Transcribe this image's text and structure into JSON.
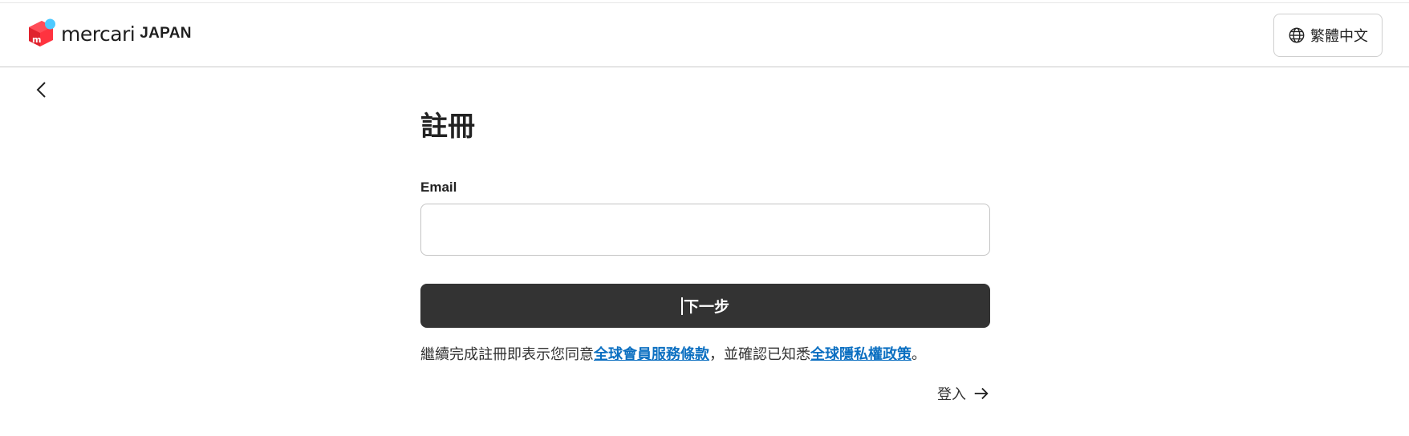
{
  "header": {
    "logo": {
      "wordmark": "mercari",
      "country": "JAPAN",
      "mark_letter": "m",
      "icon": "mercari-logo-icon"
    },
    "language_button": {
      "label": "繁體中文",
      "icon": "globe-icon"
    }
  },
  "nav": {
    "back_icon": "chevron-left-icon"
  },
  "form": {
    "title": "註冊",
    "email_label": "Email",
    "email_value": "",
    "email_placeholder": "",
    "next_button_label": "下一步"
  },
  "terms": {
    "prefix": "繼續完成註冊即表示您同意",
    "terms_link": "全球會員服務條款",
    "middle": "，並確認已知悉",
    "privacy_link": "全球隱私權政策",
    "suffix": "。"
  },
  "login": {
    "label": "登入",
    "icon": "arrow-right-icon"
  },
  "colors": {
    "logo_red": "#ff333f",
    "logo_blue": "#4dc9ff",
    "button_dark": "#333333",
    "link_blue": "#0b6fc1",
    "border_gray": "#c4c4c4"
  }
}
